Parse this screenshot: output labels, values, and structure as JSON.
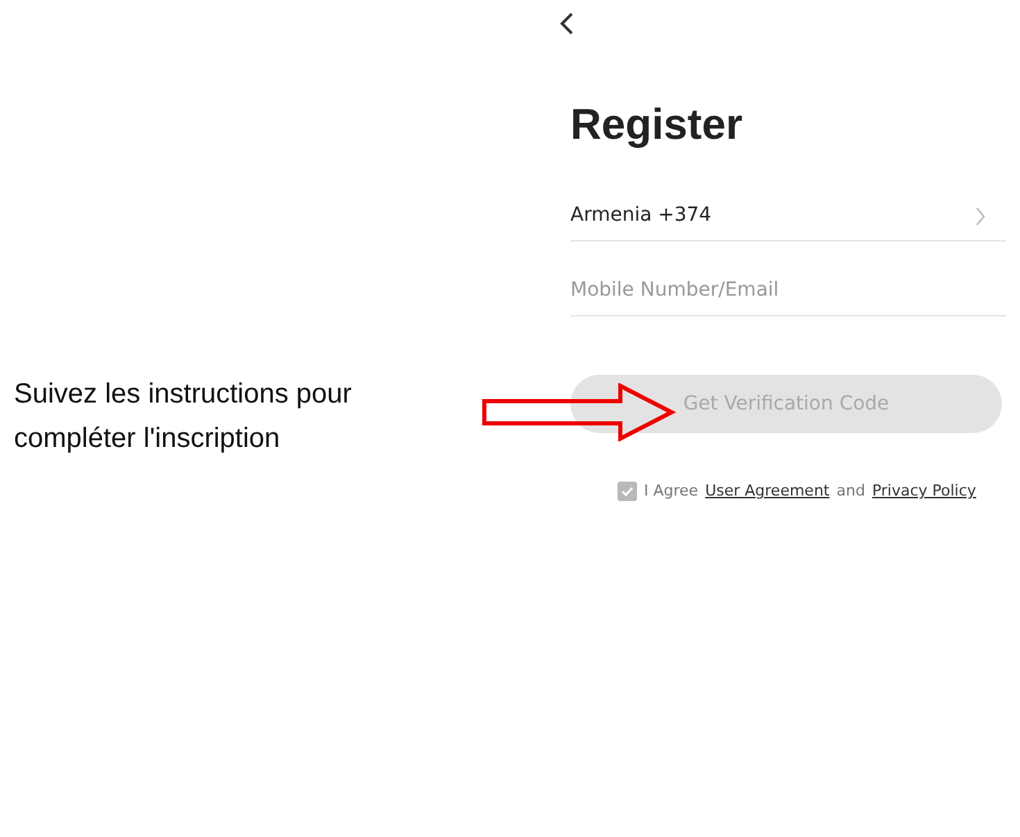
{
  "instruction": "Suivez les instructions pour compléter l'inscription",
  "screen": {
    "title": "Register",
    "country": {
      "value": "Armenia +374"
    },
    "account_field": {
      "placeholder": "Mobile Number/Email"
    },
    "button": {
      "label": "Get Verification Code",
      "disabled": true
    },
    "agreement": {
      "checked": true,
      "text": "I Agree",
      "links": [
        "User Agreement",
        "Privacy Policy"
      ],
      "joiner": "and"
    }
  }
}
